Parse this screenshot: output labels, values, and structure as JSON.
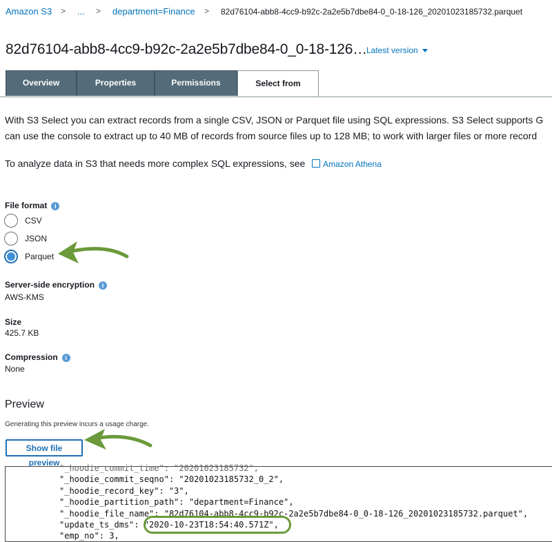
{
  "breadcrumb": {
    "root": "Amazon S3",
    "ellipsis": "...",
    "folder": "department=Finance",
    "current": "82d76104-abb8-4cc9-b92c-2a2e5b7dbe84-0_0-18-126_20201023185732.parquet",
    "separator": ">"
  },
  "object": {
    "title": "82d76104-abb8-4cc9-b92c-2a2e5b7dbe84-0_0-18-126…",
    "version_label": "Latest version"
  },
  "tabs": [
    {
      "label": "Overview",
      "active": false
    },
    {
      "label": "Properties",
      "active": false
    },
    {
      "label": "Permissions",
      "active": false
    },
    {
      "label": "Select from",
      "active": true
    }
  ],
  "intro": {
    "line1": "With S3 Select you can extract records from a single CSV, JSON or Parquet file using SQL expressions. S3 Select supports G",
    "line2": "can use the console to extract up to 40 MB of records from source files up to 128 MB; to work with larger files or more record",
    "athena_text": "To analyze data in S3 that needs more complex SQL expressions, see",
    "athena_link": "Amazon Athena"
  },
  "file_format": {
    "label": "File format",
    "options": [
      {
        "label": "CSV",
        "selected": false
      },
      {
        "label": "JSON",
        "selected": false
      },
      {
        "label": "Parquet",
        "selected": true
      }
    ]
  },
  "encryption": {
    "label": "Server-side encryption",
    "value": "AWS-KMS"
  },
  "size": {
    "label": "Size",
    "value": "425.7 KB"
  },
  "compression": {
    "label": "Compression",
    "value": "None"
  },
  "preview": {
    "heading": "Preview",
    "charge_note": "Generating this preview incurs a usage charge.",
    "button_label": "Show file preview",
    "code_lines": [
      "\"_hoodie_commit_time\": \"20201023185732\",",
      "\"_hoodie_commit_seqno\": \"20201023185732_0_2\",",
      "\"_hoodie_record_key\": \"3\",",
      "\"_hoodie_partition_path\": \"department=Finance\",",
      "\"_hoodie_file_name\": \"82d76104-abb8-4cc9-b92c-2a2e5b7dbe84-0_0-18-126_20201023185732.parquet\",",
      "\"update_ts_dms\": \"2020-10-23T18:54:40.571Z\",",
      "\"emp_no\": 3,"
    ]
  },
  "colors": {
    "link": "#0073bb",
    "tab_inactive": "#546b7a",
    "annotation_green": "#6a9a3a",
    "radio_selected": "#3f8fd6"
  }
}
